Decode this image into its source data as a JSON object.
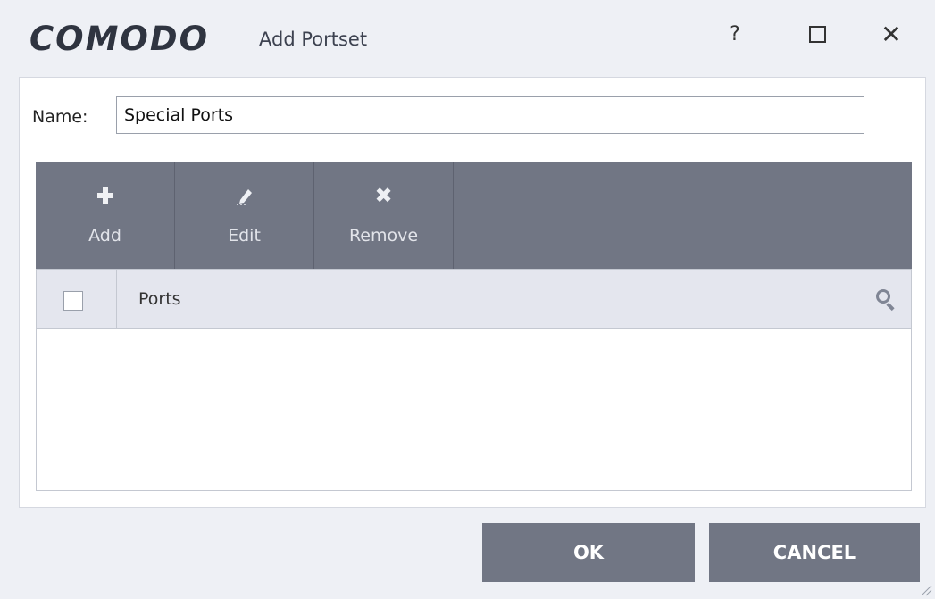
{
  "window": {
    "logo_text": "COMODO",
    "title": "Add Portset",
    "help_glyph": "?",
    "close_glyph": "✕"
  },
  "form": {
    "name_label": "Name:",
    "name_value": "Special Ports"
  },
  "toolbar": {
    "items": [
      {
        "label": "Add",
        "icon": "plus-icon"
      },
      {
        "label": "Edit",
        "icon": "pencil-icon"
      },
      {
        "label": "Remove",
        "icon": "x-icon"
      }
    ]
  },
  "grid": {
    "column_label": "Ports",
    "rows": []
  },
  "footer": {
    "ok_label": "OK",
    "cancel_label": "CANCEL"
  },
  "colors": {
    "background": "#eef0f5",
    "toolbar": "#717684",
    "button": "#717684",
    "header_row": "#e4e6ee"
  }
}
